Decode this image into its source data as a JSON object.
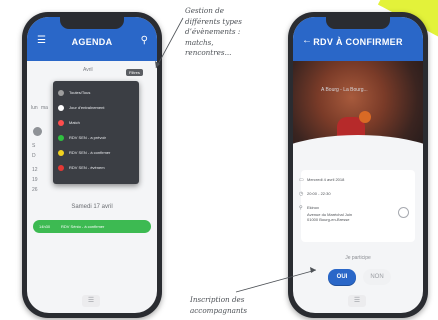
{
  "annotations": {
    "top": [
      "Gestion de",
      "différents types",
      "d’évènements :",
      "matchs,",
      "rencontres..."
    ],
    "bottom": [
      "Inscription des",
      "accompagnants"
    ]
  },
  "left_phone": {
    "header": {
      "title": "AGENDA",
      "menu_icon": "menu-icon",
      "search_icon": "search-icon"
    },
    "calendar_labels": {
      "month": "Avril",
      "lun": "lun",
      "mar": "ma",
      "day_s": "S",
      "day_d": "D",
      "w1": "12",
      "w2": "19",
      "w3": "26"
    },
    "filter_chip": "Filtres",
    "filter_menu": [
      {
        "label": "Toutes/Tous",
        "color": "#9e9e9e"
      },
      {
        "label": "Jour d'entraînement",
        "color": "#ffffff"
      },
      {
        "label": "Match",
        "color": "#ff4d4d"
      },
      {
        "label": "RDV SEN - a prévoir",
        "color": "#30c040"
      },
      {
        "label": "RDV SEN - à confirmer",
        "color": "#f2d21f"
      },
      {
        "label": "RDV SEN - évènem",
        "color": "#e53935"
      }
    ],
    "selected_date": "Samedi 17 avril",
    "event": {
      "time": "14h30",
      "label": "RDV Sénio - à confirmer",
      "color": "#3dba52"
    },
    "home_icon": "list-icon"
  },
  "right_phone": {
    "header": {
      "title": "RDV À CONFIRMER",
      "back_icon": "arrow-left-icon"
    },
    "photo_caption": "A Bourg - La Bourg...",
    "details": {
      "date": "Mercredi 4 avril 2018",
      "time": "20:00 - 22:30",
      "place_name": "Ekinox",
      "address_1": "Avenue du Maréchal Juin",
      "address_2": "01000 Bourg-en-Bresse"
    },
    "participate_label": "Je participe",
    "yes_label": "OUI",
    "no_label": "NON",
    "home_icon": "list-icon"
  },
  "colors": {
    "primary": "#2a67c8",
    "accent_yellow": "#e3f23a",
    "success": "#3dba52"
  }
}
